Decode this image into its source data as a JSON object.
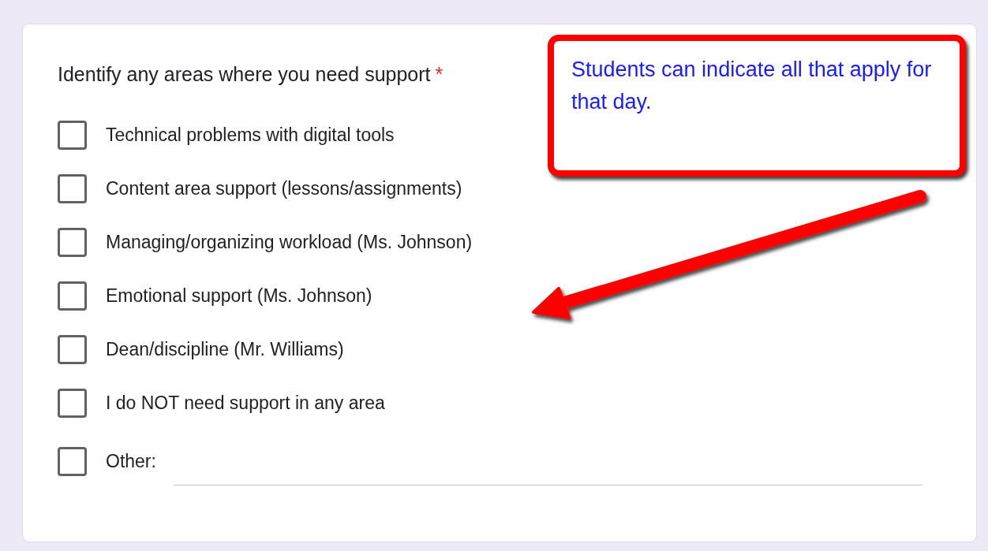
{
  "question": {
    "text": "Identify any areas where you need support",
    "required_mark": "*"
  },
  "options": [
    {
      "kind": "option",
      "label": "Technical problems with digital tools",
      "checked": false
    },
    {
      "kind": "option",
      "label": "Content area support (lessons/assignments)",
      "checked": false
    },
    {
      "kind": "option",
      "label": "Managing/organizing workload (Ms. Johnson)",
      "checked": false
    },
    {
      "kind": "option",
      "label": "Emotional support (Ms. Johnson)",
      "checked": false
    },
    {
      "kind": "option",
      "label": "Dean/discipline (Mr. Williams)",
      "checked": false
    },
    {
      "kind": "option",
      "label": "I do NOT need support in any area",
      "checked": false
    },
    {
      "kind": "other",
      "label": "Other:",
      "checked": false
    }
  ],
  "callout": {
    "text": "Students can indicate all that apply for that day."
  }
}
